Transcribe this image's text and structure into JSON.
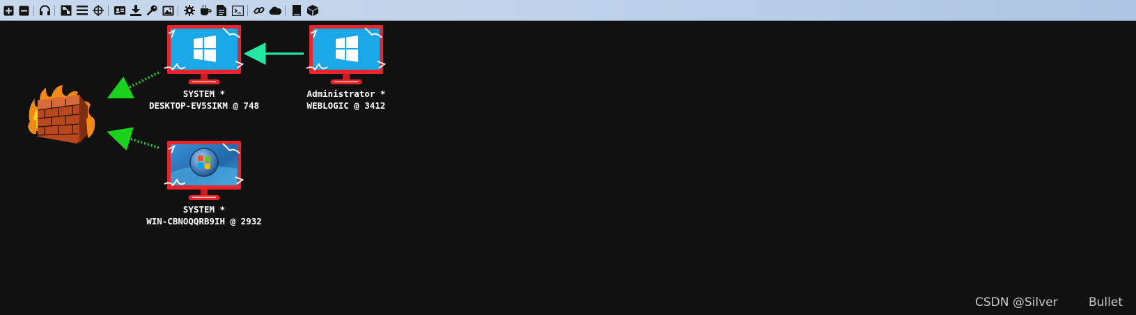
{
  "toolbar": {
    "buttons": [
      {
        "name": "connect-icon"
      },
      {
        "name": "disconnect-icon"
      },
      {
        "name": "headset-icon"
      },
      {
        "name": "pivot-graph-icon"
      },
      {
        "name": "session-table-icon"
      },
      {
        "name": "target-icon"
      },
      {
        "name": "credentials-icon"
      },
      {
        "name": "download-icon"
      },
      {
        "name": "key-icon"
      },
      {
        "name": "screenshot-icon"
      },
      {
        "name": "settings-icon"
      },
      {
        "name": "coffee-icon"
      },
      {
        "name": "document-icon"
      },
      {
        "name": "terminal-icon"
      },
      {
        "name": "link-icon"
      },
      {
        "name": "cloud-icon"
      },
      {
        "name": "book-icon"
      },
      {
        "name": "package-icon"
      }
    ]
  },
  "graph": {
    "nodes": [
      {
        "id": "firewall",
        "type": "firewall",
        "name": "firewall-node"
      },
      {
        "id": "desktop",
        "type": "windows10",
        "user": "SYSTEM *",
        "host": "DESKTOP-EV5SIKM @ 748"
      },
      {
        "id": "weblogic",
        "type": "windows10",
        "user": "Administrator *",
        "host": "WEBLOGIC @ 3412"
      },
      {
        "id": "win7",
        "type": "windows7",
        "user": "SYSTEM *",
        "host": "WIN-CBNOQQRB9IH @ 2932"
      }
    ],
    "edges": [
      {
        "from": "weblogic",
        "to": "desktop",
        "style": "solid",
        "color": "#22e8a4"
      },
      {
        "from": "desktop",
        "to": "firewall",
        "style": "dotted",
        "color": "#19d21b"
      },
      {
        "from": "win7",
        "to": "firewall",
        "style": "dotted",
        "color": "#19d21b"
      }
    ],
    "colors": {
      "monitor_frame": "#e8252b",
      "win10_screen": "#1aa8e8",
      "win7_screen": "#2b7fc2",
      "lightning": "#ffffff",
      "background": "#111111"
    }
  },
  "watermark": {
    "left": "CSDN @Silver",
    "right": "Bullet"
  }
}
